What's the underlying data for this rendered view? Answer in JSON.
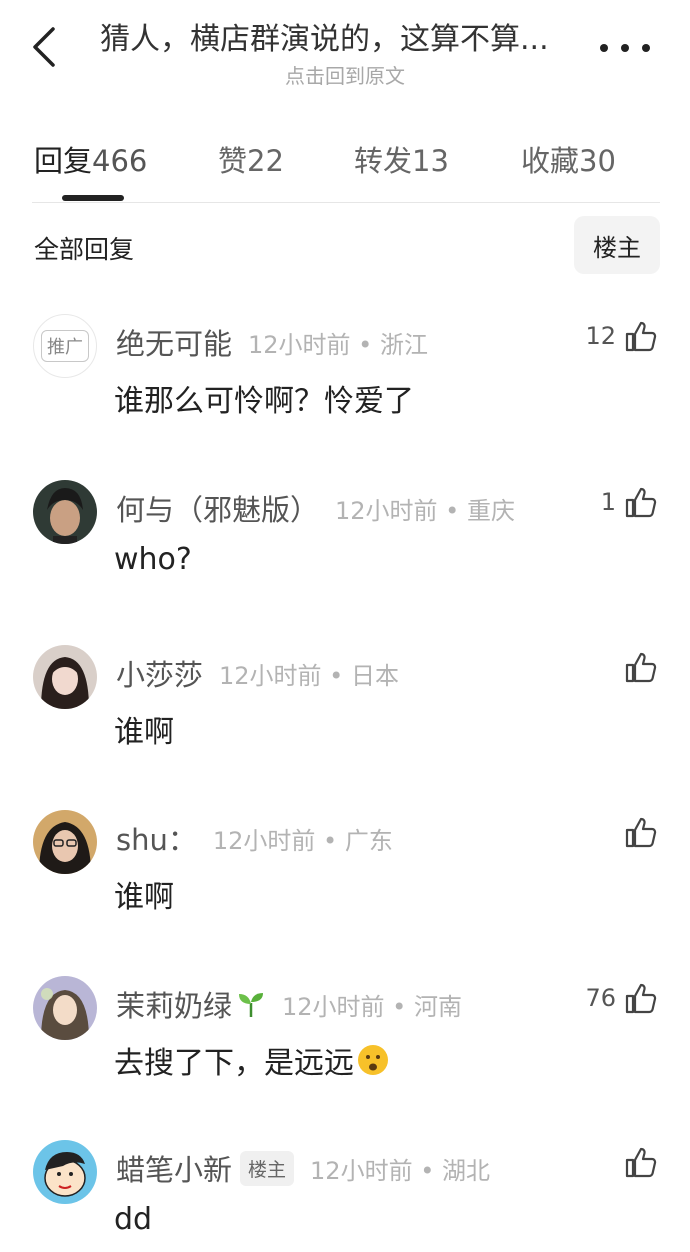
{
  "header": {
    "title": "猜人，横店群演说的，这算不算...",
    "subtitle": "点击回到原文"
  },
  "tabs": [
    {
      "label": "回复",
      "count": "466"
    },
    {
      "label": "赞",
      "count": "22"
    },
    {
      "label": "转发",
      "count": "13"
    },
    {
      "label": "收藏",
      "count": "30"
    }
  ],
  "section": {
    "title": "全部回复",
    "filter_label": "楼主"
  },
  "comments": [
    {
      "ad_tag": "推广",
      "username": "绝无可能",
      "meta": "12小时前 • 浙江",
      "likes": "12",
      "text": "谁那么可怜啊？怜爱了"
    },
    {
      "username": "何与（邪魅版）",
      "meta": "12小时前 • 重庆",
      "likes": "1",
      "text": "who?"
    },
    {
      "username": "小莎莎",
      "meta": "12小时前 • 日本",
      "likes": "",
      "text": "谁啊"
    },
    {
      "username": "shu：",
      "meta": "12小时前 • 广东",
      "likes": "",
      "text": "谁啊"
    },
    {
      "username": "茉莉奶绿",
      "meta": "12小时前 • 河南",
      "likes": "76",
      "text": "去搜了下，是远远"
    },
    {
      "username": "蜡笔小新",
      "op_badge": "楼主",
      "meta": "12小时前 • 湖北",
      "likes": "",
      "text": "dd"
    }
  ],
  "icons": {
    "back": "chevron-left-icon",
    "more": "more-dots-icon",
    "like": "thumbs-up-icon",
    "sprout": "seedling-emoji",
    "face": "frowning-face-emoji"
  },
  "colors": {
    "text_primary": "#222222",
    "text_meta": "#b3b3b3",
    "subtitle": "#a8a8a8"
  }
}
